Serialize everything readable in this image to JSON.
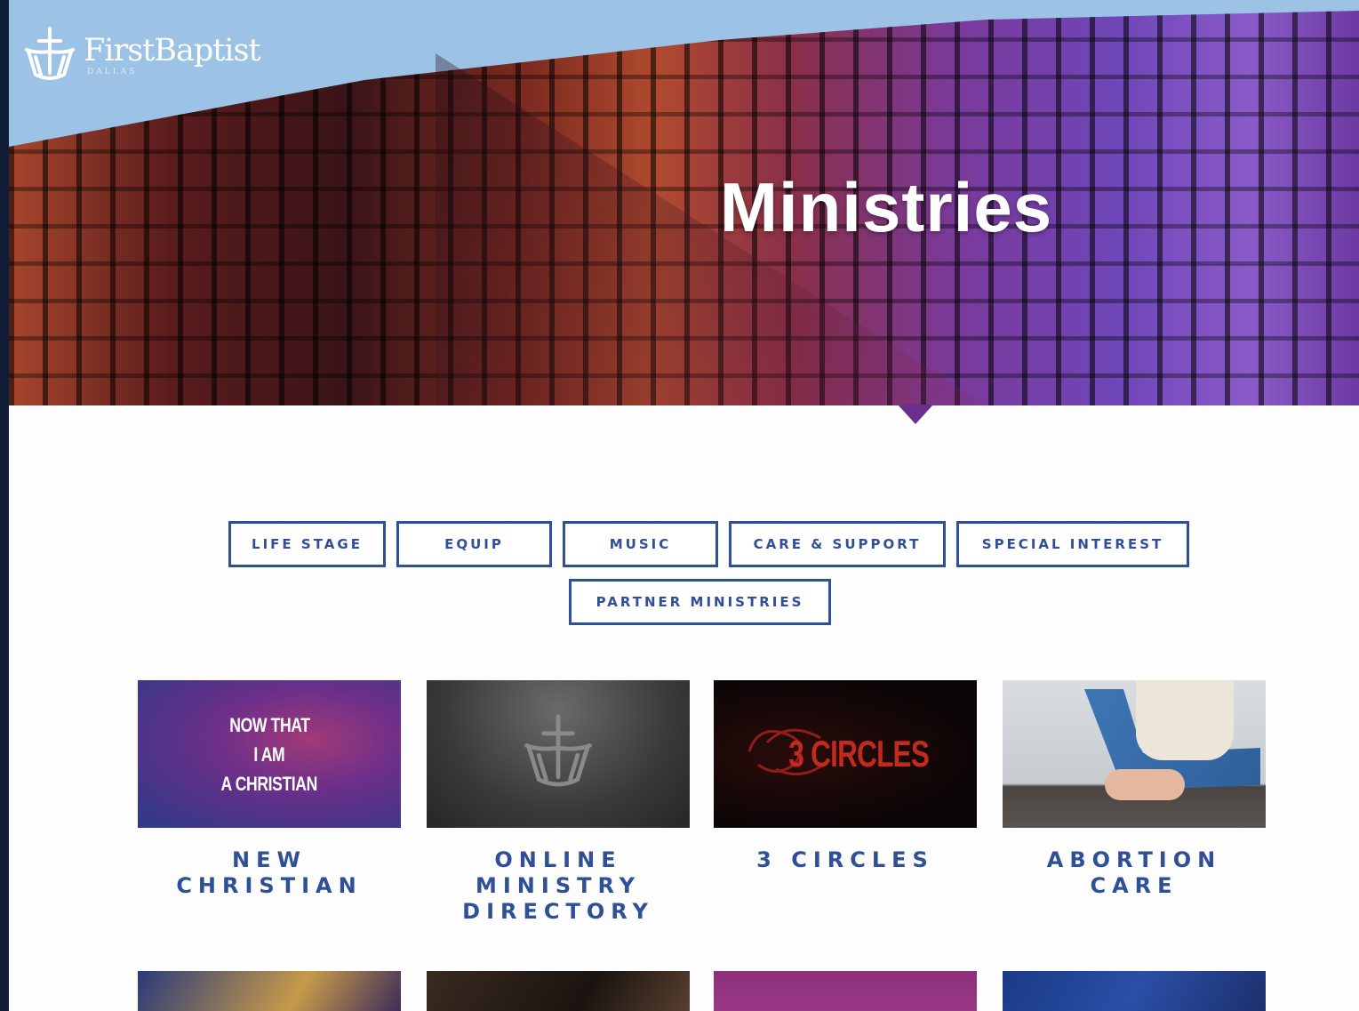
{
  "brand": {
    "name": "FirstBaptist",
    "sub": "DALLAS",
    "logo_icon": "cross-ship-icon"
  },
  "hero": {
    "title": "Ministries"
  },
  "colors": {
    "accent": "#2f4f97",
    "page_bg": "#fdfdfd",
    "outer_bg": "#0f1d36"
  },
  "filters": {
    "row1": [
      "LIFE STAGE",
      "EQUIP",
      "MUSIC",
      "CARE & SUPPORT",
      "SPECIAL INTEREST"
    ],
    "row2": [
      "PARTNER MINISTRIES"
    ]
  },
  "cards": [
    {
      "label": "NEW CHRISTIAN",
      "image_text": [
        "NOW THAT",
        "I AM",
        "A CHRISTIAN"
      ]
    },
    {
      "label": "ONLINE MINISTRY DIRECTORY",
      "image_icon": "cross-ship-icon"
    },
    {
      "label": "3 CIRCLES",
      "image_text": "3 CIRCLES"
    },
    {
      "label": "ABORTION CARE"
    }
  ]
}
